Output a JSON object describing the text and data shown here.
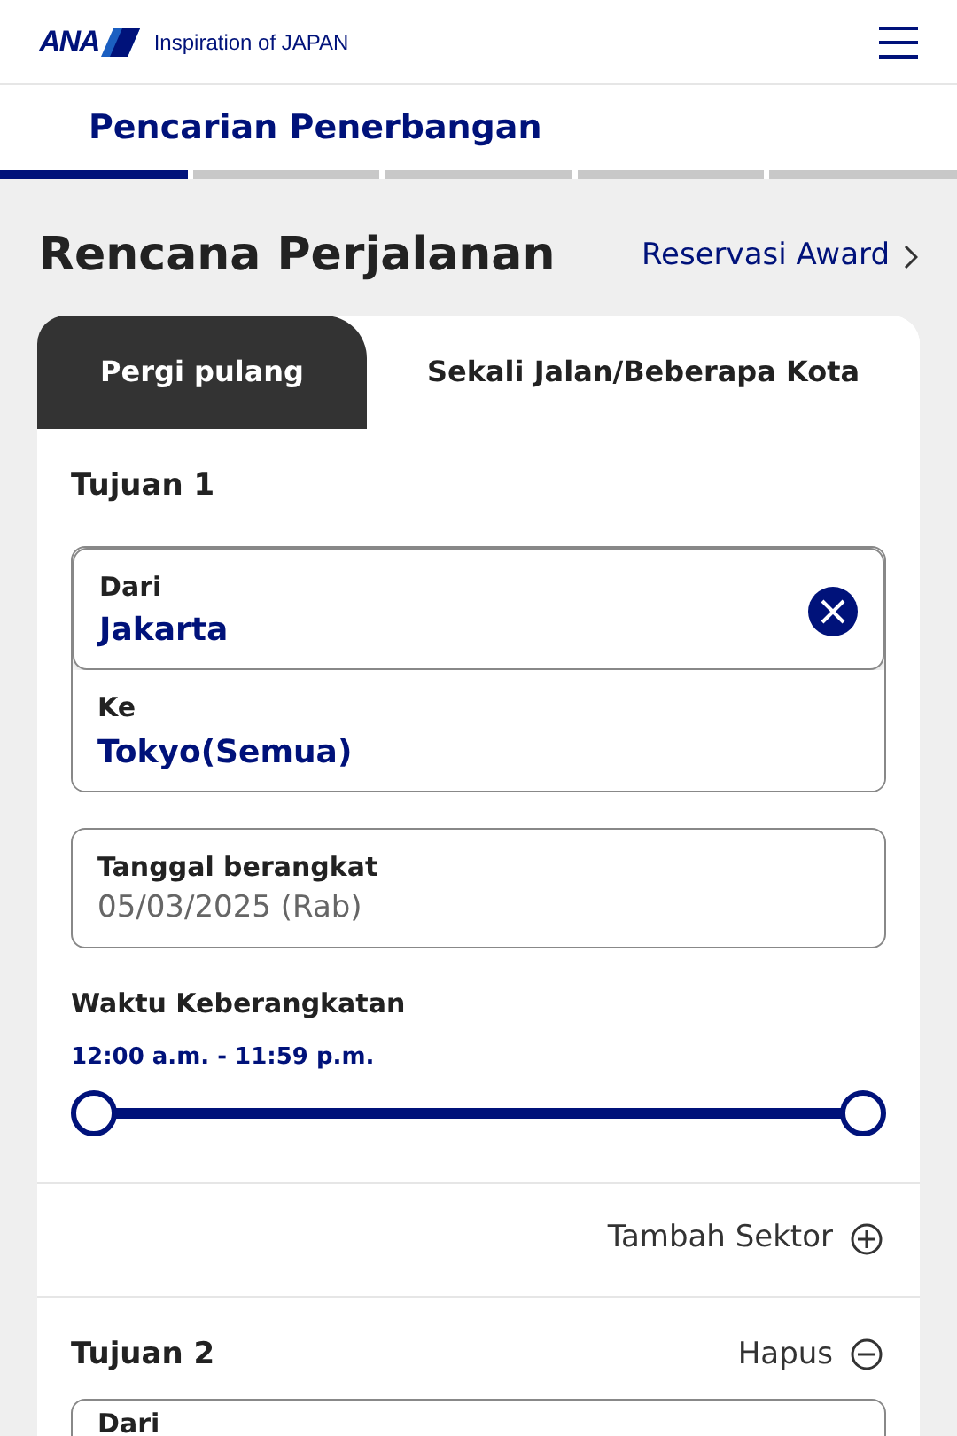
{
  "header": {
    "logo": "ANA",
    "tagline": "Inspiration of JAPAN"
  },
  "page_tab": {
    "label": "Pencarian Penerbangan"
  },
  "steps": [
    {
      "selected": true
    },
    {
      "selected": false
    },
    {
      "selected": false
    },
    {
      "selected": false
    },
    {
      "selected": false
    }
  ],
  "title": "Rencana Perjalanan",
  "award_link": "Reservasi Award",
  "trip_tabs": [
    {
      "label": "Pergi pulang",
      "selected": false
    },
    {
      "label": "Sekali Jalan/Beberapa Kota",
      "selected": true
    }
  ],
  "segments": [
    {
      "title": "Tujuan 1",
      "from": {
        "label": "Dari",
        "value": "Jakarta"
      },
      "to": {
        "label": "Ke",
        "value": "Tokyo(Semua)"
      },
      "date": {
        "label": "Tanggal berangkat",
        "value": "05/03/2025 (Rab)"
      },
      "time": {
        "label": "Waktu Keberangkatan",
        "range": "12:00 a.m. - 11:59 p.m.",
        "low": {
          "level": 0
        },
        "high": {
          "level": 1
        }
      },
      "add": "Tambah Sektor"
    },
    {
      "title": "Tujuan 2",
      "remove": "Hapus",
      "from": {
        "label": "Dari"
      }
    }
  ]
}
